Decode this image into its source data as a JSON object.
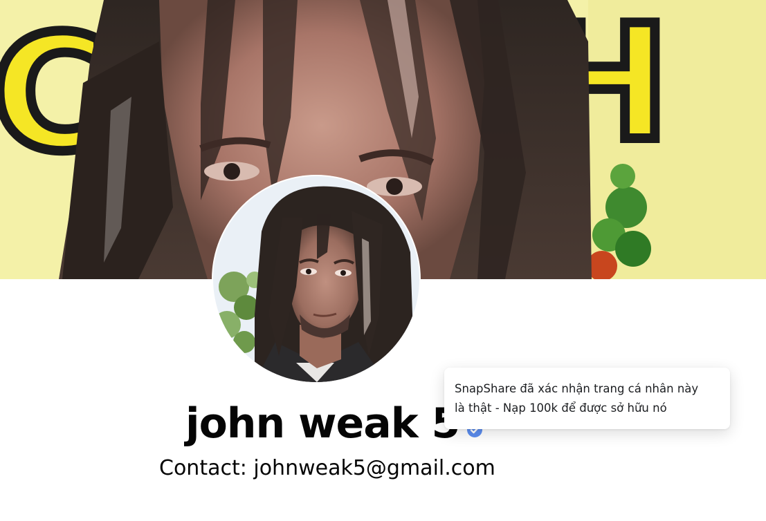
{
  "profile": {
    "name": "john weak 5",
    "contact": "Contact: johnweak5@gmail.com",
    "verified_icon": "verified-badge-icon",
    "verified_color": "#5b8def"
  },
  "cover": {
    "letters_left": "C",
    "letters_right": "H",
    "background_color": "#f4f1a8",
    "accent_color": "#f5e625"
  },
  "tooltip": {
    "line1": "SnapShare đã xác nhận trang cá nhân này",
    "line2": "là thật - Nạp 100k để được sở hữu nó"
  }
}
